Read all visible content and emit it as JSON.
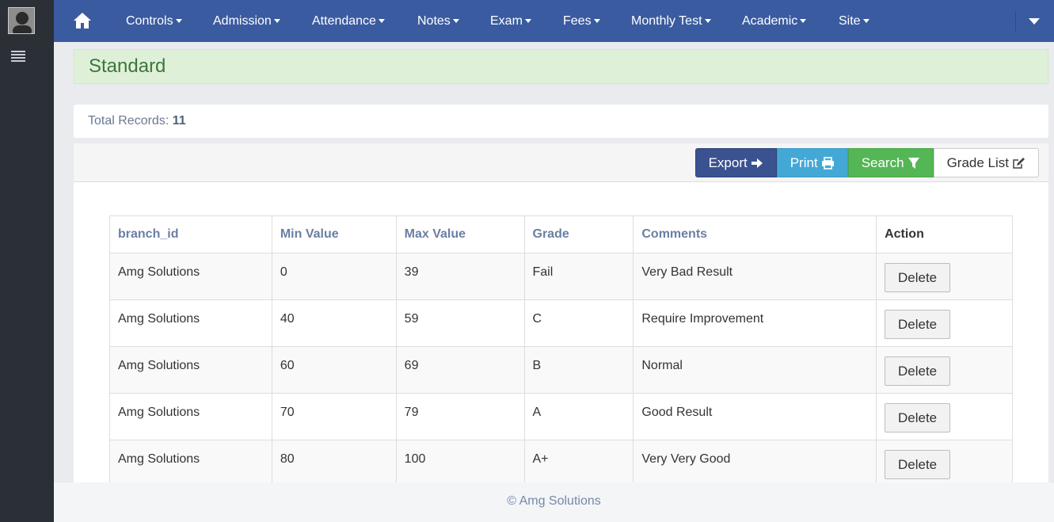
{
  "nav": {
    "items": [
      {
        "label": "Controls"
      },
      {
        "label": "Admission"
      },
      {
        "label": "Attendance"
      },
      {
        "label": "Notes"
      },
      {
        "label": "Exam"
      },
      {
        "label": "Fees"
      },
      {
        "label": "Monthly Test"
      },
      {
        "label": "Academic"
      },
      {
        "label": "Site"
      }
    ]
  },
  "page": {
    "title": "Standard"
  },
  "records": {
    "label": "Total Records:",
    "count": "11"
  },
  "toolbar": {
    "export_label": "Export",
    "print_label": "Print",
    "search_label": "Search",
    "grade_list_label": "Grade List"
  },
  "table": {
    "headers": [
      "branch_id",
      "Min Value",
      "Max Value",
      "Grade",
      "Comments",
      "Action"
    ],
    "delete_label": "Delete",
    "rows": [
      {
        "branch": "Amg Solutions",
        "min": "0",
        "max": "39",
        "grade": "Fail",
        "comment": "Very Bad Result"
      },
      {
        "branch": "Amg Solutions",
        "min": "40",
        "max": "59",
        "grade": "C",
        "comment": "Require Improvement"
      },
      {
        "branch": "Amg Solutions",
        "min": "60",
        "max": "69",
        "grade": "B",
        "comment": "Normal"
      },
      {
        "branch": "Amg Solutions",
        "min": "70",
        "max": "79",
        "grade": "A",
        "comment": "Good Result"
      },
      {
        "branch": "Amg Solutions",
        "min": "80",
        "max": "100",
        "grade": "A+",
        "comment": "Very Very Good"
      }
    ]
  },
  "footer": {
    "text": "© Amg Solutions"
  },
  "icons": {
    "home": "home-icon",
    "export": "arrow-right-icon",
    "print": "printer-icon",
    "search": "filter-icon",
    "grade_list": "edit-icon",
    "menu": "hamburger-icon"
  },
  "colors": {
    "navbar": "#3a5ba0",
    "sidebar": "#2b2f36",
    "success": "#55b656",
    "info": "#44a8d6",
    "primary": "#3a5290"
  }
}
